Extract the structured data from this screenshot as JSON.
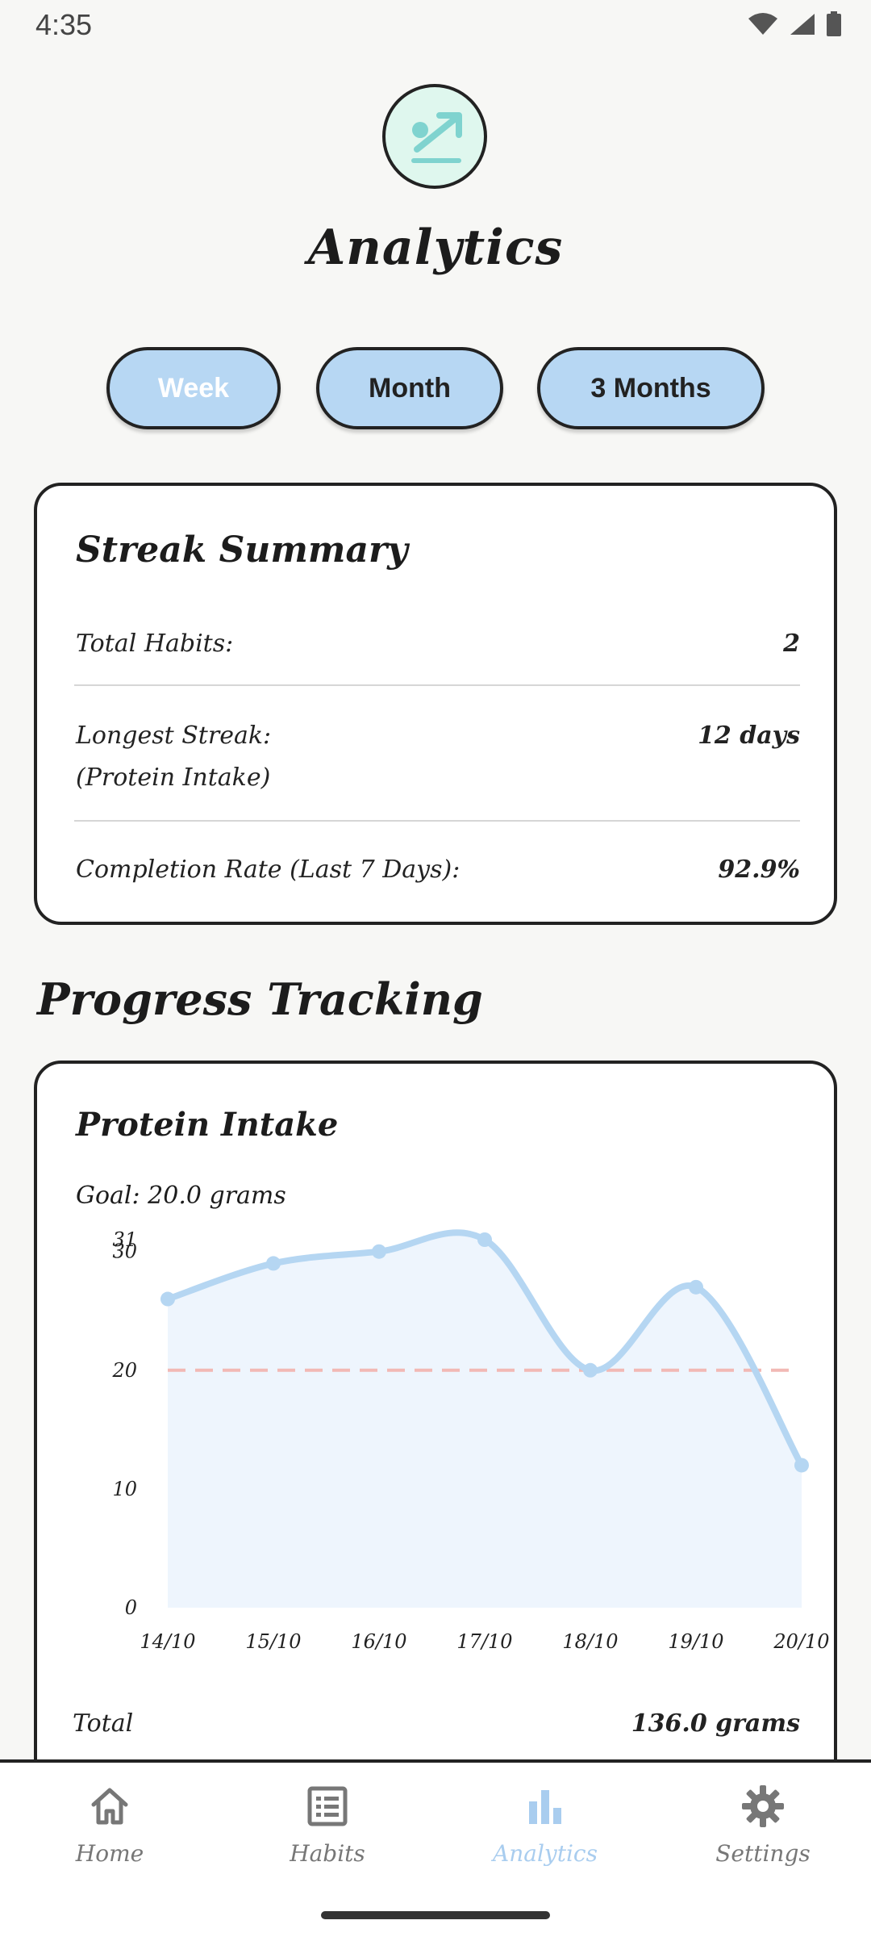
{
  "status_bar": {
    "time": "4:35"
  },
  "header": {
    "title": "Analytics"
  },
  "range_tabs": [
    {
      "label": "Week",
      "active": true
    },
    {
      "label": "Month",
      "active": false
    },
    {
      "label": "3 Months",
      "active": false
    }
  ],
  "streak_summary": {
    "title": "Streak Summary",
    "total_habits_label": "Total Habits:",
    "total_habits_value": "2",
    "longest_streak_label": "Longest Streak:",
    "longest_streak_sub": "(Protein Intake)",
    "longest_streak_value": "12 days",
    "completion_label": "Completion Rate (Last 7 Days):",
    "completion_value": "92.9%"
  },
  "progress_section": {
    "title": "Progress Tracking"
  },
  "progress_card": {
    "title": "Protein Intake",
    "goal": "Goal: 20.0 grams",
    "total_label": "Total",
    "total_value": "136.0 grams"
  },
  "chart_data": {
    "type": "area",
    "x": [
      "14/10",
      "15/10",
      "16/10",
      "17/10",
      "18/10",
      "19/10",
      "20/10"
    ],
    "values": [
      26,
      29,
      30,
      31,
      20,
      27,
      12
    ],
    "goal_line": 20,
    "y_ticks": [
      "0",
      "10",
      "20",
      "30",
      "31"
    ],
    "ylim": [
      0,
      31
    ],
    "colors": {
      "line": "#b5d6f2",
      "fill": "#eef5fd",
      "goal": "#f2b9b5"
    }
  },
  "bottom_nav": [
    {
      "label": "Home",
      "icon": "home-icon",
      "active": false
    },
    {
      "label": "Habits",
      "icon": "list-icon",
      "active": false
    },
    {
      "label": "Analytics",
      "icon": "bar-chart-icon",
      "active": true
    },
    {
      "label": "Settings",
      "icon": "gear-icon",
      "active": false
    }
  ]
}
